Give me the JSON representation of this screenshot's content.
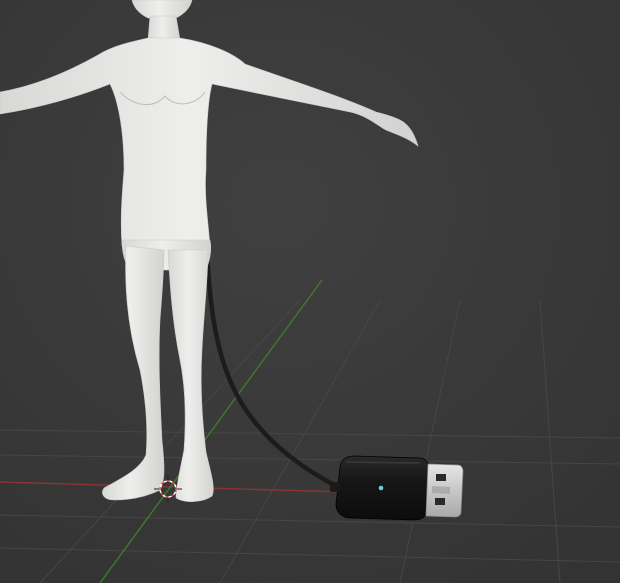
{
  "viewport": {
    "background_color": "#3d3d3d",
    "grid_color": "#454545",
    "x_axis_color": "#8a3434",
    "y_axis_color": "#3f7a2a"
  },
  "scene": {
    "figure_color": "#e6e6e4",
    "cable_color": "#1e1e1e",
    "device_body_color": "#161616",
    "usb_plug_color": "#d2d2d2",
    "status_led_color": "#5fd3e6"
  },
  "icons": {
    "origin_cursor": "3d-cursor-icon"
  }
}
